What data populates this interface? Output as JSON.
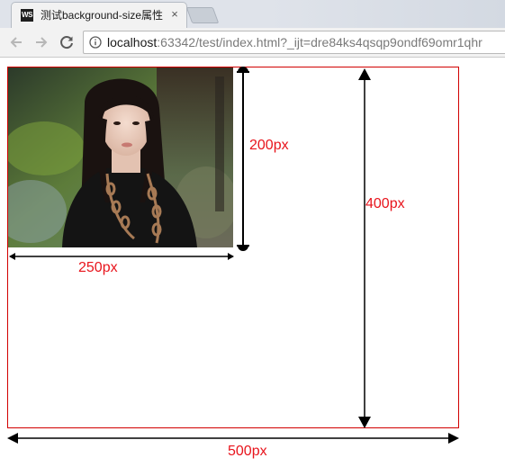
{
  "tab": {
    "favicon_text": "WS",
    "title": "测试background-size属性",
    "close_glyph": "×"
  },
  "toolbar": {
    "back_icon": "back-arrow-icon",
    "forward_icon": "forward-arrow-icon",
    "reload_icon": "reload-icon",
    "info_icon": "info-icon",
    "url_host": "localhost",
    "url_rest": ":63342/test/index.html?_ijt=dre84ks4qsqp9ondf69omr1qhr"
  },
  "page": {
    "image_label": "photo-of-woman",
    "image_width_label": "250px",
    "image_height_label": "200px",
    "box_height_label": "400px",
    "box_width_label": "500px",
    "box_border_color": "#d20000",
    "label_color": "#e8141c"
  }
}
